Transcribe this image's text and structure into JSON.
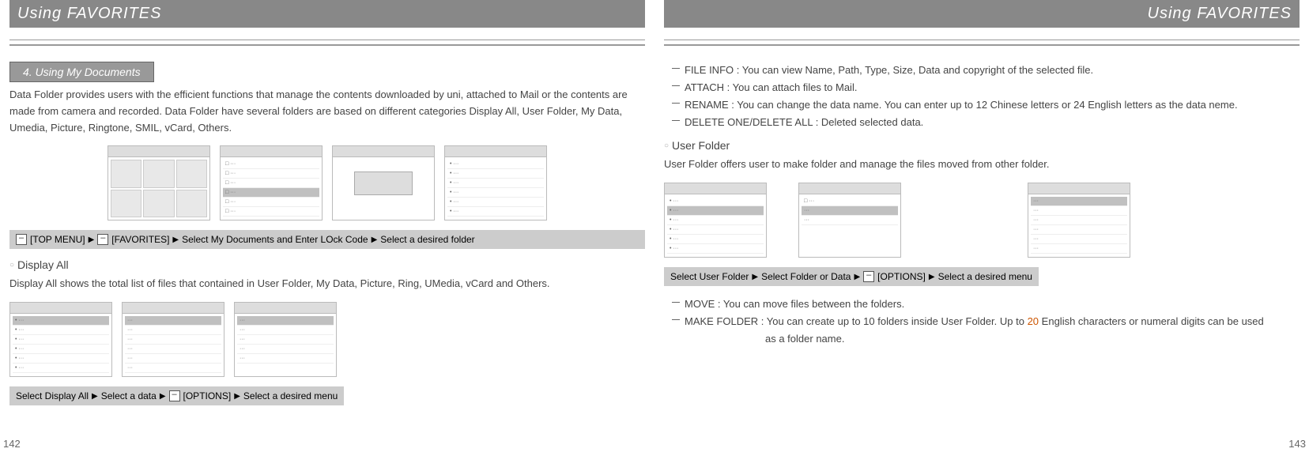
{
  "header": {
    "left_title": "Using FAVORITES",
    "right_title": "Using FAVORITES"
  },
  "left_page": {
    "section_tab": "4. Using My Documents",
    "intro_text": "Data Folder provides users with the efficient functions that manage the contents downloaded by uni, attached to Mail or the contents are made from camera and recorded. Data Folder have several folders are based on different categories Display All, User Folder, My Data, Umedia, Picture, Ringtone, SMIL, vCard, Others.",
    "nav1": {
      "step1": "[TOP MENU]",
      "step2": "[FAVORITES]",
      "step3": "Select My Documents and Enter LOck Code",
      "step4": "Select a desired folder"
    },
    "subsection1": {
      "title": "Display All",
      "text": "Display All shows the total list of files that contained in User Folder, My Data, Picture, Ring, UMedia, vCard and Others."
    },
    "nav2": {
      "step1": "Select Display All",
      "step2": "Select a data",
      "step3": "[OPTIONS]",
      "step4": "Select a desired menu"
    },
    "page_num": "142"
  },
  "right_page": {
    "options": {
      "item1": "FILE INFO : You can view Name, Path, Type, Size, Data and copyright of the selected file.",
      "item2": "ATTACH : You can attach files to Mail.",
      "item3": "RENAME : You can change the data name. You can enter up to 12 Chinese letters or 24 English letters as the data neme.",
      "item4": "DELETE ONE/DELETE ALL : Deleted selected data."
    },
    "subsection2": {
      "title": "User Folder",
      "text": "User Folder offers user to make folder and manage the files moved from other folder."
    },
    "nav3": {
      "step1": "Select User Folder",
      "step2": "Select Folder or Data",
      "step3": "[OPTIONS]",
      "step4": "Select a desired menu"
    },
    "options2": {
      "item1": "MOVE : You can move files between the folders.",
      "item2_prefix": "MAKE FOLDER : You can create up to 10 folders inside User Folder. Up to",
      "item2_accent": "20",
      "item2_suffix": "English characters or numeral digits can be used",
      "item2_cont": "as a folder name."
    },
    "page_num": "143"
  }
}
